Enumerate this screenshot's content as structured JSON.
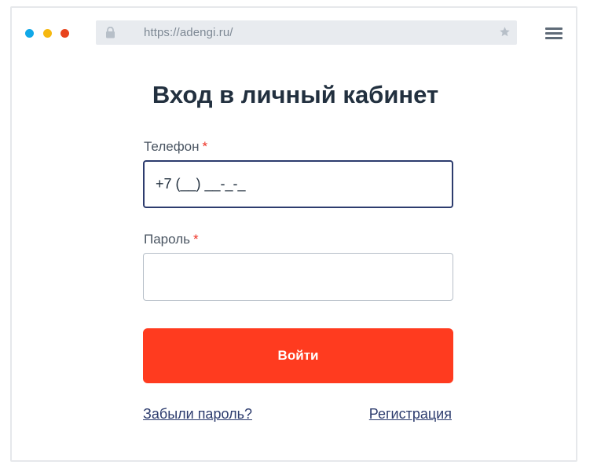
{
  "browser": {
    "url": "https://adengi.ru/",
    "controls": [
      {
        "name": "close",
        "color": "#11a8e8"
      },
      {
        "name": "minimize",
        "color": "#f6b80f"
      },
      {
        "name": "maximize",
        "color": "#e8431d"
      }
    ],
    "icons": [
      "lock-icon",
      "star-icon",
      "hamburger-menu-icon"
    ]
  },
  "login": {
    "title": "Вход в личный кабинет",
    "phone_label": "Телефон",
    "phone_value": "+7 (__) __-_-_",
    "password_label": "Пароль",
    "password_value": "",
    "required_mark": "*",
    "submit_label": "Войти",
    "forgot_link": "Забыли пароль?",
    "register_link": "Регистрация"
  },
  "colors": {
    "accent": "#ff3b1f",
    "focus_border": "#2d3c6e",
    "link": "#2d3c6e",
    "required": "#ee3124",
    "heading": "#22303f"
  }
}
